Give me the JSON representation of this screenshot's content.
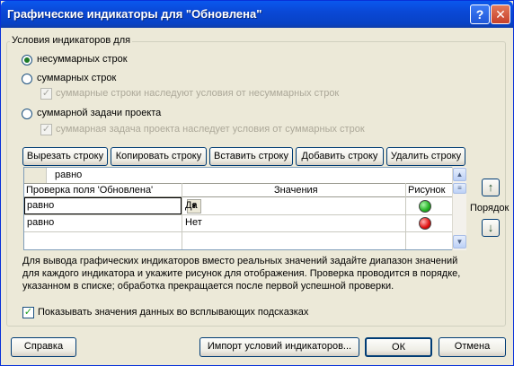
{
  "title": "Графические индикаторы для \"Обновлена\"",
  "titlebar_buttons": {
    "help": "?",
    "close": "✕"
  },
  "group": {
    "label": "Условия индикаторов для",
    "radio_nonsummary": "несуммарных строк",
    "radio_summary": "суммарных строк",
    "chk_summary_inherit": "суммарные строки наследуют условия от несуммарных строк",
    "radio_project": "суммарной задачи проекта",
    "chk_project_inherit": "суммарная задача проекта наследует условия от суммарных строк"
  },
  "row_buttons": {
    "cut": "Вырезать строку",
    "copy": "Копировать строку",
    "paste": "Вставить строку",
    "add": "Добавить строку",
    "delete": "Удалить строку"
  },
  "grid": {
    "edit_value": "равно",
    "columns": [
      "Проверка поля 'Обновлена'",
      "Значения",
      "Рисунок"
    ],
    "rows": [
      {
        "test": "равно",
        "value": "Да",
        "image": "green-circle-icon",
        "color": "#22b022"
      },
      {
        "test": "равно",
        "value": "Нет",
        "image": "red-circle-icon",
        "color": "#e01010"
      }
    ]
  },
  "order_label": "Порядок",
  "info_text": [
    "Для вывода графических индикаторов вместо реальных значений задайте диапазон значений",
    "для каждого индикатора и укажите рисунок для отображения.  Проверка проводится в порядке,",
    "указанном в списке; обработка прекращается после первой успешной проверки."
  ],
  "show_tooltips": {
    "label": "Показывать значения данных во всплывающих подсказках",
    "checked": true
  },
  "footer": {
    "help": "Справка",
    "import": "Импорт условий индикаторов...",
    "ok": "ОК",
    "cancel": "Отмена"
  }
}
